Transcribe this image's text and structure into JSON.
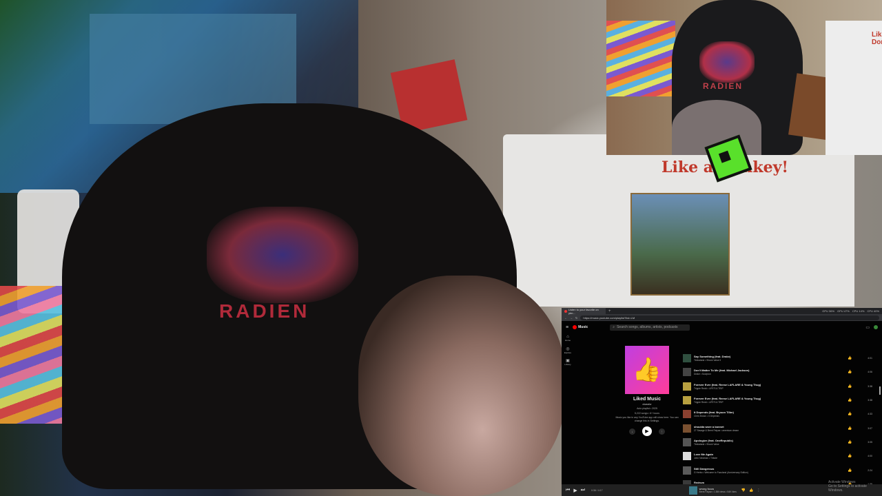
{
  "stream": {
    "hoodie_logo_text": "RADIEN",
    "shirt_text": "Like a Donkey!",
    "pip_logo_text": "RADIEN",
    "pip_shirt_text": "Like Donkey"
  },
  "browser": {
    "tab_title": "Listen to your favorite on ytm...",
    "new_tab": "+",
    "stats": [
      "GPU 36%",
      "GPU 47%",
      "CPU 14%",
      "CPU 40%"
    ],
    "url": "https://music.youtube.com/playlist?list=LM"
  },
  "ytmusic": {
    "logo": "Music",
    "search_placeholder": "Search songs, albums, artists, podcasts",
    "sidebar": [
      {
        "icon": "home-icon",
        "label": "Home"
      },
      {
        "icon": "explore-icon",
        "label": "Explore"
      },
      {
        "icon": "library-icon",
        "label": "Library"
      }
    ],
    "playlist": {
      "title": "Liked Music",
      "owner": "cbassfor",
      "meta1": "Auto playlist • 2025",
      "meta2": "5,222 songs • 6+ hours",
      "desc": "Music you like in any YouTube app will show here. You can change this in Settings."
    },
    "songs": [
      {
        "title": "Say Something (feat. Drake)",
        "artist": "Timbaland • Shock Value II",
        "duration": "4:01",
        "color": "#2f4f3f"
      },
      {
        "title": "Don't Matter To Me (feat. Michael Jackson)",
        "artist": "Drake • Scorpion",
        "duration": "4:06",
        "color": "#444"
      },
      {
        "title": "Forever Ever (feat. Reese LAFLARE & Young Thug)",
        "artist": "Trippie Redd • LIFE'S A TRIP",
        "duration": "3:38",
        "color": "#b8a040"
      },
      {
        "title": "Forever Ever (feat. Reese LAFLARE & Young Thug)",
        "artist": "Trippie Redd • LIFE'S A TRIP",
        "duration": "3:38",
        "color": "#b8a040"
      },
      {
        "title": "It Depends (feat. Bryson Tiller)",
        "artist": "Chris Brown • It Depends",
        "duration": "4:33",
        "color": "#8a4030"
      },
      {
        "title": "shoulda wore a bonnet",
        "artist": "27 Savage & Brent Faiyaz • american dream",
        "duration": "3:07",
        "color": "#7a5030"
      },
      {
        "title": "Apologize (feat. OneRepublic)",
        "artist": "Timbaland • Shock Value",
        "duration": "3:05",
        "color": "#555"
      },
      {
        "title": "Love Me Again",
        "artist": "John Newman • Tribute",
        "duration": "4:00",
        "color": "#ddd"
      },
      {
        "title": "Still Dangerous",
        "artist": "G Herbo • Welcome to Fazoland (Anniversary Edition)",
        "duration": "2:24",
        "color": "#5a5a5a"
      },
      {
        "title": "Redrum",
        "artist": "Lil Durk • The Voice",
        "duration": "1:35",
        "color": "#3a3a3a"
      },
      {
        "title": "Hard Times (feat. Hurricane Wisdom)",
        "artist": "",
        "duration": "",
        "color": "#6a4a2a"
      }
    ],
    "player": {
      "time": "0:36 / 4:17",
      "title": "wrong focus",
      "artist": "Brent Faiyaz • 1.8M views • 54K likes"
    }
  },
  "watermark": {
    "line1": "Activate Windows",
    "line2": "Go to Settings to activate Windows."
  }
}
